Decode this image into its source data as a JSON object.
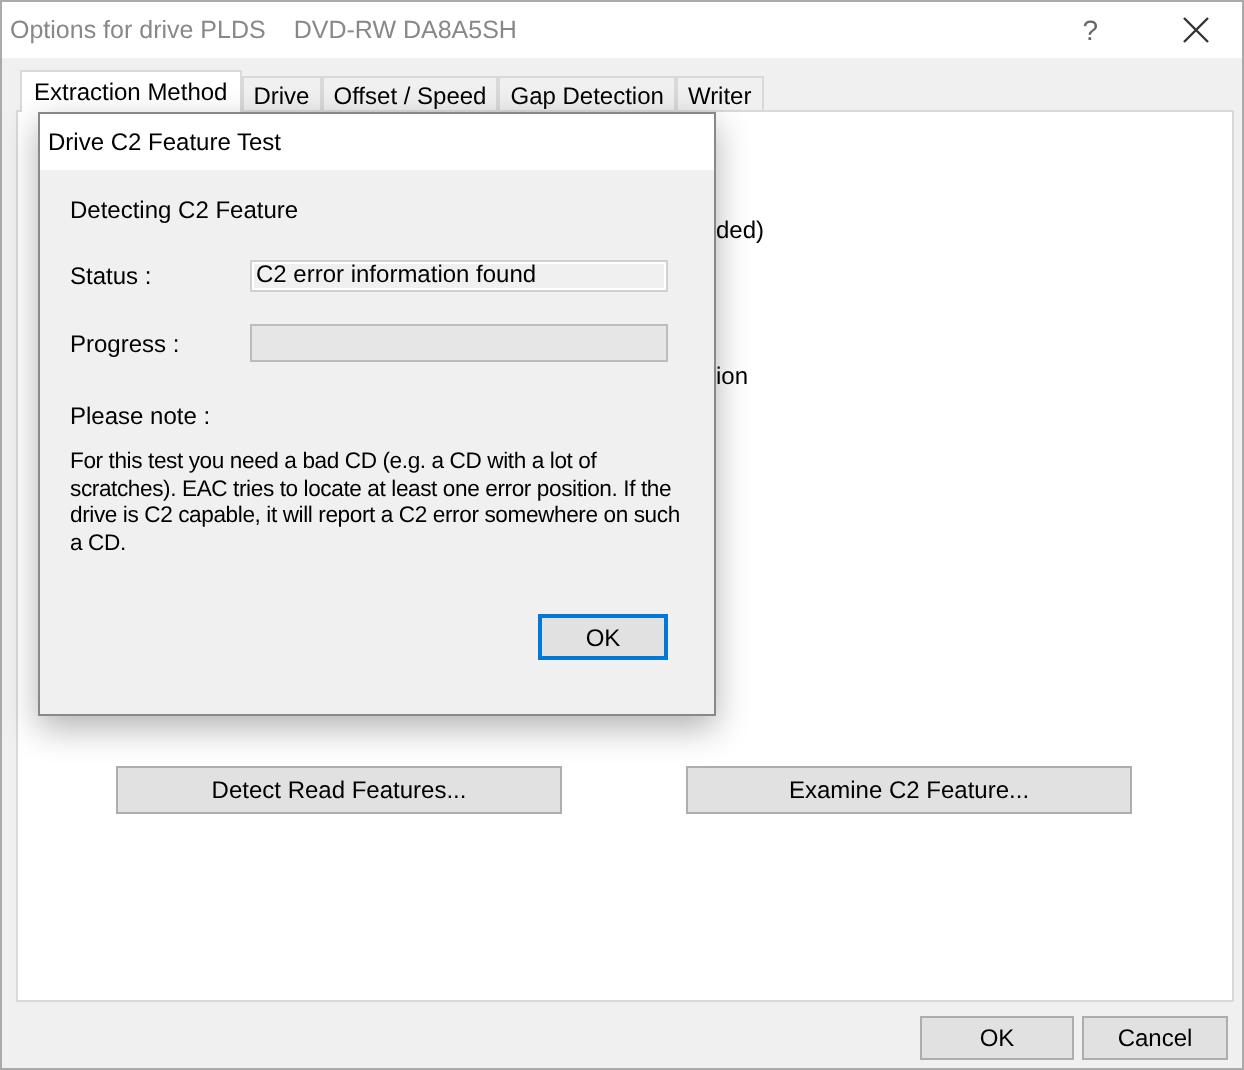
{
  "window": {
    "title": "Options for drive PLDS",
    "drive": "DVD-RW DA8A5SH",
    "help": "?"
  },
  "tabs": [
    {
      "label": "Extraction Method",
      "selected": true
    },
    {
      "label": "Drive",
      "selected": false
    },
    {
      "label": "Offset / Speed",
      "selected": false
    },
    {
      "label": "Gap Detection",
      "selected": false
    },
    {
      "label": "Writer",
      "selected": false
    }
  ],
  "panel": {
    "hidden_texts": [
      "ded)",
      "ion"
    ],
    "buttons": [
      "Detect Read Features...",
      "Examine C2 Feature..."
    ]
  },
  "dialog": {
    "title": "Drive C2 Feature Test",
    "heading": "Detecting C2 Feature",
    "status_label": "Status :",
    "status_value": "C2 error information found",
    "progress_label": "Progress :",
    "progress": {
      "level": 0
    },
    "note_label": "Please note :",
    "note": "For this test you need a bad CD (e.g. a CD with a lot of scratches). EAC tries to locate at least one error position. If the drive is C2 capable, it will report a C2 error somewhere on such a CD.",
    "ok": "OK"
  },
  "buttons": [
    "OK",
    "Cancel"
  ]
}
